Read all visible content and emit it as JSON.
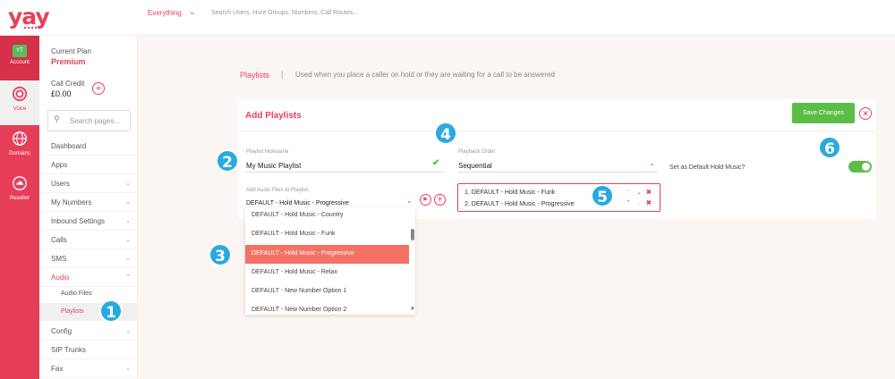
{
  "top": {
    "filter": "Everything",
    "search_placeholder": "Search Users, Hunt Groups, Numbers, Call Routes..."
  },
  "rail": [
    {
      "label": "Account",
      "avatar": "YT"
    },
    {
      "label": "Voice",
      "icon": "voice-icon"
    },
    {
      "label": "Domains",
      "icon": "globe-icon"
    },
    {
      "label": "Reseller",
      "icon": "cloud-icon"
    }
  ],
  "sidebar": {
    "plan_label": "Current Plan",
    "plan_value": "Premium",
    "credit_label": "Call Credit",
    "credit_value": "£0.00",
    "search_placeholder": "Search pages...",
    "nav": [
      "Dashboard",
      "Apps",
      "Users",
      "My Numbers",
      "Inbound Settings",
      "Calls",
      "SMS",
      "Audio"
    ],
    "audio_sub": [
      "Audio Files",
      "Playlists"
    ],
    "nav_after": [
      "Config",
      "SIP Trunks",
      "Fax"
    ]
  },
  "badges": [
    "1",
    "2",
    "3",
    "4",
    "5",
    "6"
  ],
  "page": {
    "title": "Playlists",
    "separator": "|",
    "description": "Used when you place a caller on hold or they are waiting for a call to be answered"
  },
  "card": {
    "title": "Add Playlists",
    "save_label": "Save Changes",
    "nickname_label": "Playlist Nickname",
    "nickname_value": "My Music Playlist",
    "order_label": "Playback Order",
    "order_value": "Sequential",
    "default_label": "Set as Default Hold Music?",
    "default_on": true,
    "audio_label": "Add Audio Files to Playlist",
    "audio_value": "DEFAULT - Hold Music - Progressive",
    "playlist": [
      "1. DEFAULT - Hold Music - Funk",
      "2. DEFAULT - Hold Music - Progressive"
    ]
  },
  "dropdown": {
    "options": [
      "DEFAULT - Hold Music - Country",
      "DEFAULT - Hold Music - Funk",
      "DEFAULT - Hold Music - Progressive",
      "DEFAULT - Hold Music - Relax",
      "DEFAULT - New Number Option 1",
      "DEFAULT - New Number Option 2"
    ],
    "selected": "DEFAULT - Hold Music - Progressive"
  },
  "colors": {
    "brand": "#e8405a",
    "success": "#5bbd46",
    "badge": "#29a9e0",
    "selected_option": "#f37264"
  }
}
